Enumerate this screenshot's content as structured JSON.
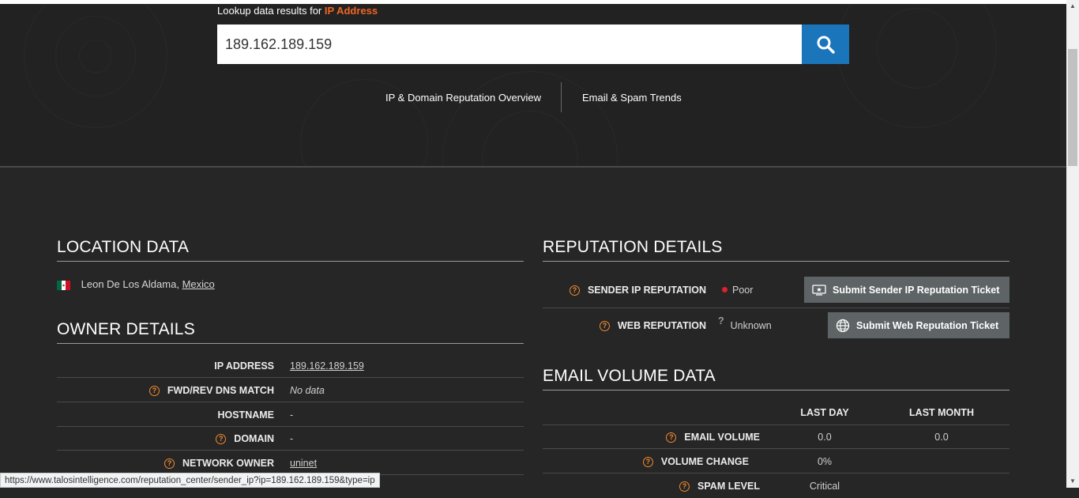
{
  "header": {
    "lookup_prefix": "Lookup data results for",
    "lookup_type": "IP Address",
    "search_value": "189.162.189.159",
    "nav": [
      "IP & Domain Reputation Overview",
      "Email & Spam Trends"
    ]
  },
  "location": {
    "title": "LOCATION DATA",
    "city": "Leon De Los Aldama,",
    "country": "Mexico"
  },
  "owner": {
    "title": "OWNER DETAILS",
    "rows": [
      {
        "label": "IP ADDRESS",
        "value": "189.162.189.159"
      },
      {
        "label": "FWD/REV DNS MATCH",
        "value": "No data"
      },
      {
        "label": "HOSTNAME",
        "value": "-"
      },
      {
        "label": "DOMAIN",
        "value": "-"
      },
      {
        "label": "NETWORK OWNER",
        "value": "uninet"
      }
    ]
  },
  "reputation": {
    "title": "REPUTATION DETAILS",
    "sender_label": "SENDER IP REPUTATION",
    "sender_value": "Poor",
    "sender_button": "Submit Sender IP Reputation Ticket",
    "web_label": "WEB REPUTATION",
    "web_value": "Unknown",
    "web_button": "Submit Web Reputation Ticket",
    "poor_color": "#e0202a"
  },
  "email_volume": {
    "title": "EMAIL VOLUME DATA",
    "columns": [
      "LAST DAY",
      "LAST MONTH"
    ],
    "rows": [
      {
        "label": "EMAIL VOLUME",
        "last_day": "0.0",
        "last_month": "0.0"
      },
      {
        "label": "VOLUME CHANGE",
        "last_day": "0%",
        "last_month": ""
      },
      {
        "label": "SPAM LEVEL",
        "last_day": "Critical",
        "last_month": ""
      }
    ]
  },
  "status_bar": {
    "url": "https://www.talosintelligence.com/reputation_center/sender_ip?ip=189.162.189.159&type=ip"
  },
  "colors": {
    "accent": "#f26522",
    "search_button": "#1b75bb",
    "background": "#262626"
  }
}
